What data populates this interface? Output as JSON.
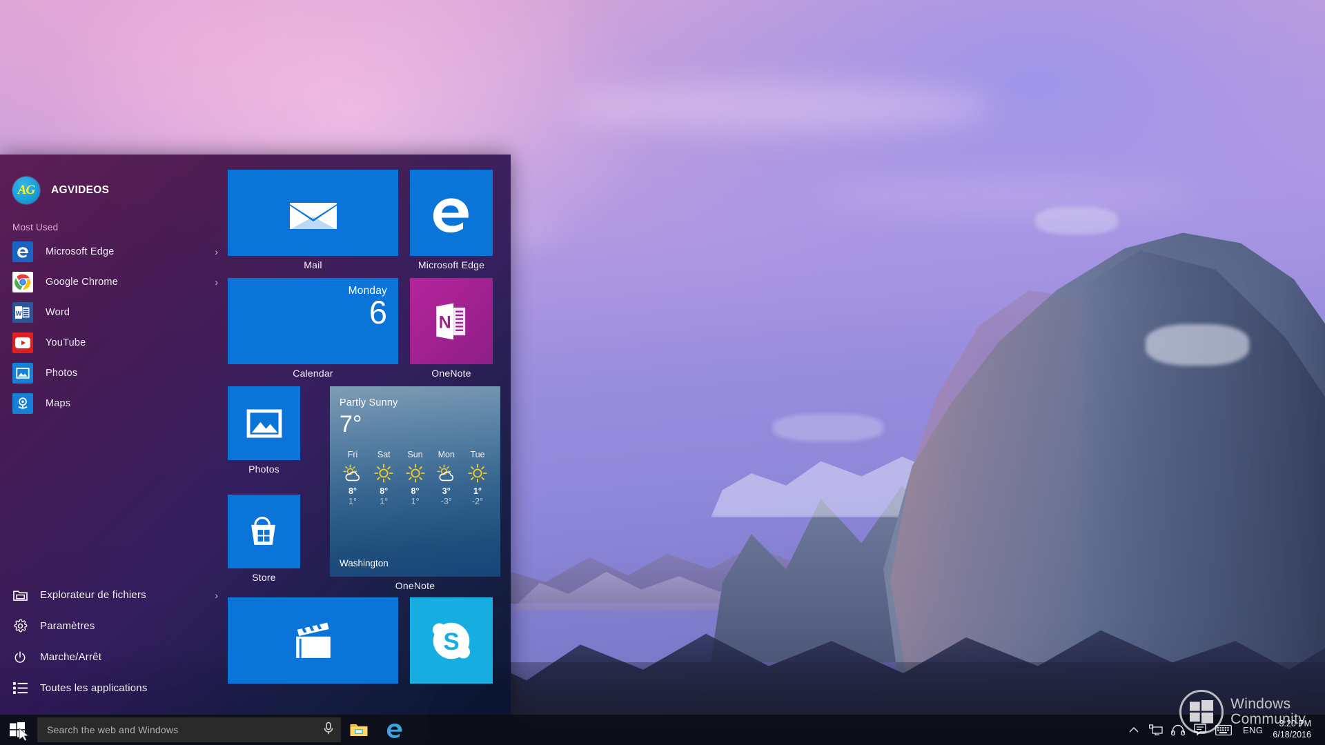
{
  "desktop": {
    "wallpaper_description": "Half Dome Yosemite at dusk with purple-pink sky"
  },
  "start_menu": {
    "user": {
      "name": "AGVIDEOS",
      "avatar_initials": "AG"
    },
    "most_used_header": "Most Used",
    "most_used": [
      {
        "label": "Microsoft Edge",
        "icon": "edge-icon",
        "has_submenu": true
      },
      {
        "label": "Google Chrome",
        "icon": "chrome-icon",
        "has_submenu": true
      },
      {
        "label": "Word",
        "icon": "word-icon",
        "has_submenu": false
      },
      {
        "label": "YouTube",
        "icon": "youtube-icon",
        "has_submenu": false
      },
      {
        "label": "Photos",
        "icon": "photos-icon",
        "has_submenu": false
      },
      {
        "label": "Maps",
        "icon": "maps-icon",
        "has_submenu": false
      }
    ],
    "system_items": [
      {
        "label": "Explorateur de fichiers",
        "icon": "file-explorer-icon",
        "has_submenu": true
      },
      {
        "label": "Paramètres",
        "icon": "gear-icon",
        "has_submenu": false
      },
      {
        "label": "Marche/Arrêt",
        "icon": "power-icon",
        "has_submenu": false
      },
      {
        "label": "Toutes les applications",
        "icon": "all-apps-icon",
        "has_submenu": false
      }
    ],
    "tiles": [
      {
        "name": "mail",
        "caption": "Mail",
        "color": "#0b74d8"
      },
      {
        "name": "microsoft-edge",
        "caption": "Microsoft Edge",
        "color": "#0b74d8"
      },
      {
        "name": "calendar",
        "caption": "Calendar",
        "color": "#0b74d8",
        "live": {
          "day": "Monday",
          "date": "6"
        }
      },
      {
        "name": "onenote",
        "caption": "OneNote",
        "color": "#9e2190"
      },
      {
        "name": "photos",
        "caption": "Photos",
        "color": "#0b74d8"
      },
      {
        "name": "weather",
        "caption": "OneNote",
        "color": "#1f4e7c"
      },
      {
        "name": "store",
        "caption": "Store",
        "color": "#0b74d8"
      },
      {
        "name": "movies-tv",
        "caption": "",
        "color": "#0b74d8"
      },
      {
        "name": "skype",
        "caption": "",
        "color": "#16aee0"
      }
    ],
    "weather_tile": {
      "condition": "Partly Sunny",
      "current_temp": "7°",
      "city": "Washington",
      "forecast": [
        {
          "day": "Fri",
          "glyph": "partly-sunny",
          "high": "8°",
          "low": "1°"
        },
        {
          "day": "Sat",
          "glyph": "sunny",
          "high": "8°",
          "low": "1°"
        },
        {
          "day": "Sun",
          "glyph": "sunny",
          "high": "8°",
          "low": "1°"
        },
        {
          "day": "Mon",
          "glyph": "partly-sunny",
          "high": "3°",
          "low": "-3°"
        },
        {
          "day": "Tue",
          "glyph": "sunny",
          "high": "1°",
          "low": "-2°"
        }
      ]
    }
  },
  "taskbar": {
    "start_button": "start-button",
    "search_placeholder": "Search the web and Windows",
    "mic_icon": "microphone-icon",
    "pinned": [
      {
        "name": "file-explorer",
        "icon": "folder-icon"
      },
      {
        "name": "microsoft-edge",
        "icon": "edge-icon"
      }
    ],
    "tray": {
      "show_hidden": "chevron-up-icon",
      "icons": [
        {
          "name": "network",
          "icon": "network-icon"
        },
        {
          "name": "headphones",
          "icon": "headphones-icon"
        },
        {
          "name": "action-center",
          "icon": "speech-bubble-icon"
        },
        {
          "name": "touch-keyboard",
          "icon": "keyboard-icon"
        }
      ],
      "language": "ENG",
      "time": "3:20 PM",
      "date": "6/18/2016"
    }
  },
  "watermark": {
    "line1": "Windows",
    "line2": "Community"
  }
}
